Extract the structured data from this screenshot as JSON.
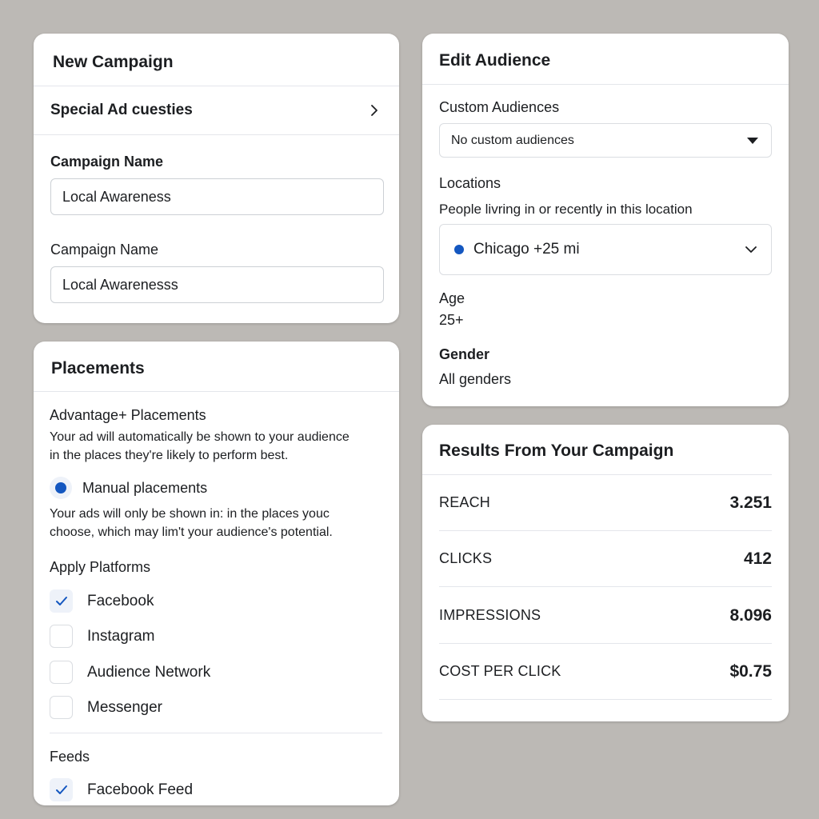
{
  "new_campaign": {
    "title": "New Campaign",
    "special_ad_label": "Special Ad cuesties",
    "field1_label": "Campaign Name",
    "field1_value": "Local Awareness",
    "field2_label": "Campaign Name",
    "field2_value": "Local Awarenesss"
  },
  "placements": {
    "title": "Placements",
    "advantage_title": "Advantage+ Placements",
    "advantage_desc_line1": "Your ad will automatically be shown to your audience",
    "advantage_desc_line2": "in the places they're likely to perform best.",
    "manual_label": "Manual placements",
    "manual_selected": true,
    "manual_desc_line1": "Your ads will only be shown in: in the places youc",
    "manual_desc_line2": "choose, which may lim't your audience's potential.",
    "platforms_title": "Apply Platforms",
    "platforms": [
      {
        "label": "Facebook",
        "checked": true
      },
      {
        "label": "Instagram",
        "checked": false
      },
      {
        "label": "Audience Network",
        "checked": false
      },
      {
        "label": "Messenger",
        "checked": false
      }
    ],
    "feeds_title": "Feeds",
    "feeds": [
      {
        "label": "Facebook Feed",
        "checked": true
      }
    ]
  },
  "audience": {
    "title": "Edit Audience",
    "custom_label": "Custom Audiences",
    "custom_value": "No custom audiences",
    "locations_label": "Locations",
    "locations_desc": "People livring in or recently in this location",
    "location_value": "Chicago +25 mi",
    "age_label": "Age",
    "age_value": "25+",
    "gender_label": "Gender",
    "gender_value": "All genders"
  },
  "results": {
    "title": "Results From Your Campaign",
    "metrics": [
      {
        "label": "REACH",
        "value": "3.251"
      },
      {
        "label": "CLICKS",
        "value": "412"
      },
      {
        "label": "IMPRESSIONS",
        "value": "8.096"
      },
      {
        "label": "COST PER CLICK",
        "value": "$0.75"
      }
    ]
  },
  "colors": {
    "accent": "#1457c0",
    "background": "#bcb9b5",
    "card": "#ffffff"
  },
  "icons": {
    "chevron_right": "chevron-right-icon",
    "caret_down": "caret-down-icon",
    "chevron_down": "chevron-down-icon",
    "check": "check-icon",
    "location_dot": "location-dot-icon"
  }
}
